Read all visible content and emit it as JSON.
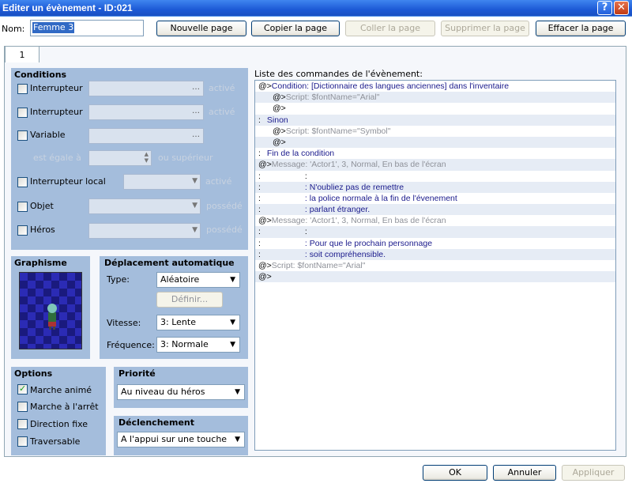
{
  "window": {
    "title": "Editer un évènement - ID:021",
    "help": "?",
    "close": "✕"
  },
  "header": {
    "name_label": "Nom:",
    "name_value": "Femme 3",
    "buttons": {
      "new_page": "Nouvelle page",
      "copy_page": "Copier la page",
      "paste_page": "Coller la page",
      "delete_page": "Supprimer la page",
      "clear_page": "Effacer la page"
    }
  },
  "tabs": [
    {
      "label": "1"
    }
  ],
  "conditions": {
    "title": "Conditions",
    "switch1": {
      "label": "Interrupteur",
      "suffix": "activé"
    },
    "switch2": {
      "label": "Interrupteur",
      "suffix": "activé"
    },
    "variable": {
      "label": "Variable",
      "equal": "est égale à",
      "or_more": "ou supérieur"
    },
    "self_switch": {
      "label": "Interrupteur local",
      "suffix": "activé"
    },
    "item": {
      "label": "Objet",
      "suffix": "possédé"
    },
    "actor": {
      "label": "Héros",
      "suffix": "possédé"
    }
  },
  "graphic": {
    "title": "Graphisme"
  },
  "autonomous": {
    "title": "Déplacement automatique",
    "type_label": "Type:",
    "type_value": "Aléatoire",
    "define": "Définir...",
    "speed_label": "Vitesse:",
    "speed_value": "3: Lente",
    "freq_label": "Fréquence:",
    "freq_value": "3: Normale"
  },
  "options": {
    "title": "Options",
    "walk": "Marche animé",
    "step": "Marche à l'arrêt",
    "dirfix": "Direction fixe",
    "through": "Traversable"
  },
  "priority": {
    "title": "Priorité",
    "value": "Au niveau du héros"
  },
  "trigger": {
    "title": "Déclenchement",
    "value": "A l'appui sur une touche"
  },
  "commands": {
    "title": "Liste des commandes de l'évènement:",
    "lines": [
      {
        "p": "@>",
        "t": "Condition: [Dictionnaire des langues anciennes] dans l'inventaire",
        "c": "c-blue",
        "i": 0
      },
      {
        "p": "@>",
        "t": "Script: $fontName=\"Arial\"",
        "c": "c-gray",
        "i": 1
      },
      {
        "p": "@>",
        "t": "",
        "c": "",
        "i": 1
      },
      {
        "p": ":",
        "t": "Sinon",
        "c": "c-blue",
        "i": 0
      },
      {
        "p": "@>",
        "t": "Script: $fontName=\"Symbol\"",
        "c": "c-gray",
        "i": 1
      },
      {
        "p": "@>",
        "t": "",
        "c": "",
        "i": 1
      },
      {
        "p": ":",
        "t": "Fin de la condition",
        "c": "c-blue",
        "i": 0
      },
      {
        "p": "@>",
        "t": "Message: 'Actor1', 3, Normal, En bas de l'écran",
        "c": "c-gray",
        "i": 0,
        "m": 1
      },
      {
        "p": ":",
        "t": ":",
        "c": "",
        "i": 2
      },
      {
        "p": ":",
        "t": ": N'oubliez pas de remettre",
        "c": "c-blue",
        "i": 2
      },
      {
        "p": ":",
        "t": ": la police normale à la fin de l'évenement",
        "c": "c-blue",
        "i": 2
      },
      {
        "p": ":",
        "t": ": parlant étranger.",
        "c": "c-blue",
        "i": 2
      },
      {
        "p": "@>",
        "t": "Message: 'Actor1', 3, Normal, En bas de l'écran",
        "c": "c-gray",
        "i": 0,
        "m": 1
      },
      {
        "p": ":",
        "t": ":",
        "c": "",
        "i": 2
      },
      {
        "p": ":",
        "t": ": Pour que le prochain personnage",
        "c": "c-blue",
        "i": 2
      },
      {
        "p": ":",
        "t": ": soit compréhensible.",
        "c": "c-blue",
        "i": 2
      },
      {
        "p": "@>",
        "t": "Script: $fontName=\"Arial\"",
        "c": "c-gray",
        "i": 0
      },
      {
        "p": "@>",
        "t": "",
        "c": "",
        "i": 0
      }
    ]
  },
  "footer": {
    "ok": "OK",
    "cancel": "Annuler",
    "apply": "Appliquer"
  },
  "colors": {
    "title_bar": "#1d5ad6",
    "panel": "#a4bddc",
    "accent_text": "#1a1a8c"
  }
}
